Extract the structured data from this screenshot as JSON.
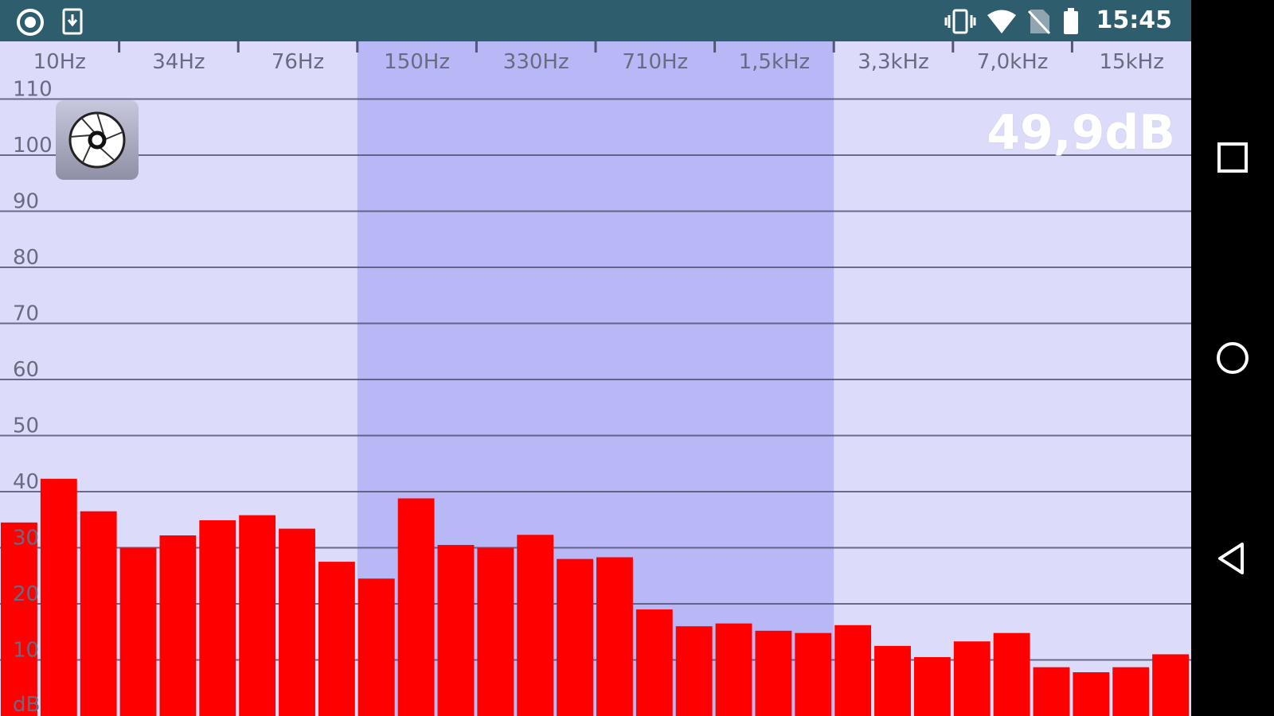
{
  "status_bar": {
    "time": "15:45",
    "left_icons": [
      "record-icon",
      "download-icon"
    ],
    "right_icons": [
      "vibrate-icon",
      "wifi-icon",
      "no-sim-icon",
      "battery-icon"
    ]
  },
  "spectrum": {
    "level_readout": "49,9dB",
    "freq_labels": [
      "10Hz",
      "34Hz",
      "76Hz",
      "150Hz",
      "330Hz",
      "710Hz",
      "1,5kHz",
      "3,3kHz",
      "7,0kHz",
      "15kHz"
    ],
    "db_labels": [
      "110",
      "100",
      "90",
      "80",
      "70",
      "60",
      "50",
      "40",
      "30",
      "20",
      "10"
    ],
    "db_unit": "dB",
    "colors": {
      "background": "#dcdcfa",
      "highlight": "#b8b8f6",
      "bar": "#ff0000",
      "grid": "#555577",
      "label": "#6a6a80"
    }
  },
  "chart_data": {
    "type": "bar",
    "ylabel": "dB",
    "ylim": [
      0,
      110
    ],
    "x_labels": [
      "10Hz",
      "34Hz",
      "76Hz",
      "150Hz",
      "330Hz",
      "710Hz",
      "1,5kHz",
      "3,3kHz",
      "7,0kHz",
      "15kHz"
    ],
    "highlight_range": [
      "150Hz",
      "1,5kHz"
    ],
    "values": [
      34.5,
      42.3,
      36.5,
      30,
      32.2,
      34.9,
      35.8,
      33.4,
      27.5,
      24.5,
      38.8,
      30.5,
      30,
      32.3,
      28,
      28.3,
      19,
      16,
      16.5,
      15.2,
      14.8,
      16.2,
      12.5,
      10.5,
      13.3,
      14.8,
      8.7,
      7.8,
      8.7,
      11
    ]
  },
  "camera_button": {
    "icon": "camera-shutter-icon"
  },
  "nav_bar": {
    "buttons": [
      "recents-icon",
      "home-icon",
      "back-icon"
    ]
  }
}
